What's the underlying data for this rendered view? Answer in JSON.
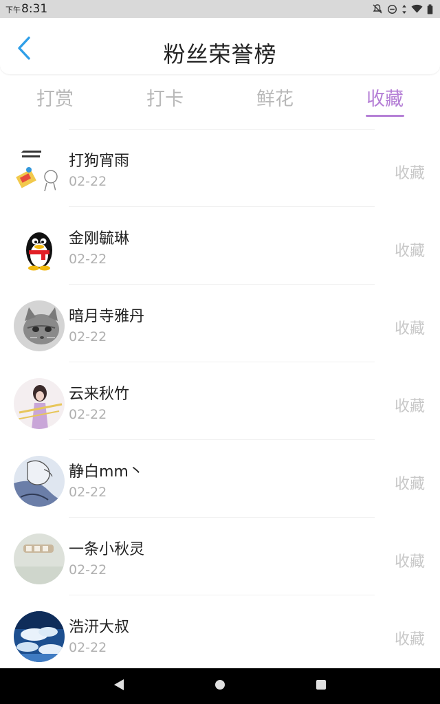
{
  "status_bar": {
    "am_pm": "下午",
    "time": "8:31",
    "icons": [
      "notification-off-icon",
      "do-not-disturb-icon",
      "data-arrows-icon",
      "wifi-icon",
      "battery-icon"
    ]
  },
  "header": {
    "title": "粉丝荣誉榜",
    "back_icon": "chevron-left-icon"
  },
  "tabs": [
    {
      "label": "打赏",
      "active": false
    },
    {
      "label": "打卡",
      "active": false
    },
    {
      "label": "鲜花",
      "active": false
    },
    {
      "label": "收藏",
      "active": true
    }
  ],
  "colors": {
    "accent": "#b57fd6",
    "back_arrow": "#2f9fe8",
    "inactive_tab": "#b8b8b8",
    "date_text": "#b0b0b0",
    "action_text": "#c8c8c8"
  },
  "fans": [
    {
      "name": "打狗宵雨",
      "date": "02-22",
      "action": "收藏",
      "avatar": "meme-sticker-avatar"
    },
    {
      "name": "金刚毓琳",
      "date": "02-22",
      "action": "收藏",
      "avatar": "qq-penguin-avatar"
    },
    {
      "name": "暗月寺雅丹",
      "date": "02-22",
      "action": "收藏",
      "avatar": "kitten-photo-avatar"
    },
    {
      "name": "云来秋竹",
      "date": "02-22",
      "action": "收藏",
      "avatar": "girl-photo-avatar"
    },
    {
      "name": "静白mm丶",
      "date": "02-22",
      "action": "收藏",
      "avatar": "sketch-illustration-avatar"
    },
    {
      "name": "一条小秋灵",
      "date": "02-22",
      "action": "收藏",
      "avatar": "pale-photo-avatar"
    },
    {
      "name": "浩汧大叔",
      "date": "02-22",
      "action": "收藏",
      "avatar": "sky-clouds-avatar"
    }
  ],
  "nav_bar": {
    "icons": [
      "back-triangle-icon",
      "home-circle-icon",
      "recents-square-icon"
    ]
  }
}
